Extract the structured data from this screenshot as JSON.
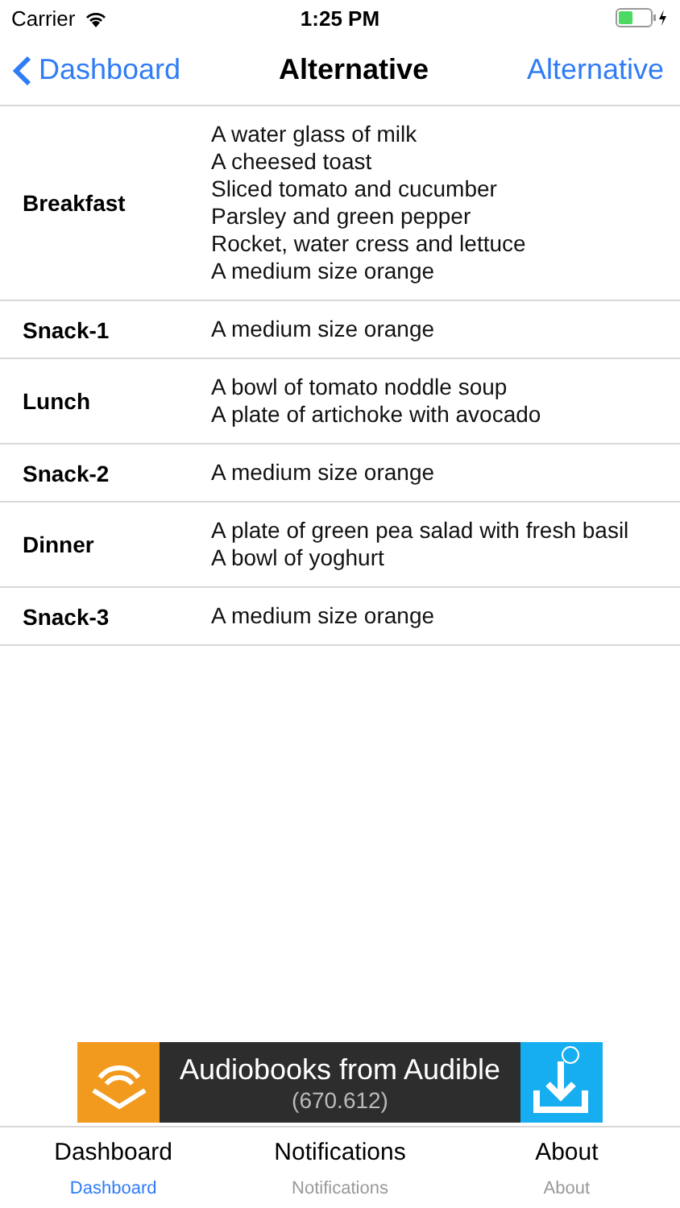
{
  "status_bar": {
    "carrier": "Carrier",
    "time": "1:25 PM"
  },
  "nav": {
    "back": "Dashboard",
    "title": "Alternative",
    "action": "Alternative"
  },
  "meals": [
    {
      "name": "Breakfast",
      "items": [
        "A water glass of milk",
        "A cheesed toast",
        "Sliced tomato and cucumber",
        "Parsley and green pepper",
        "Rocket, water cress and lettuce",
        "A medium size orange"
      ]
    },
    {
      "name": "Snack-1",
      "items": [
        "A medium size orange"
      ]
    },
    {
      "name": "Lunch",
      "items": [
        "A bowl of tomato noddle soup",
        "A plate of artichoke with avocado"
      ]
    },
    {
      "name": "Snack-2",
      "items": [
        "A medium size orange"
      ]
    },
    {
      "name": "Dinner",
      "items": [
        "A plate of green pea salad with fresh basil",
        "A bowl of yoghurt"
      ]
    },
    {
      "name": "Snack-3",
      "items": [
        "A medium size orange"
      ]
    }
  ],
  "ad": {
    "title": "Audiobooks from Audible",
    "count": "(670.612)"
  },
  "tabs": [
    {
      "title": "Dashboard",
      "label": "Dashboard",
      "selected": true
    },
    {
      "title": "Notifications",
      "label": "Notifications",
      "selected": false
    },
    {
      "title": "About",
      "label": "About",
      "selected": false
    }
  ]
}
